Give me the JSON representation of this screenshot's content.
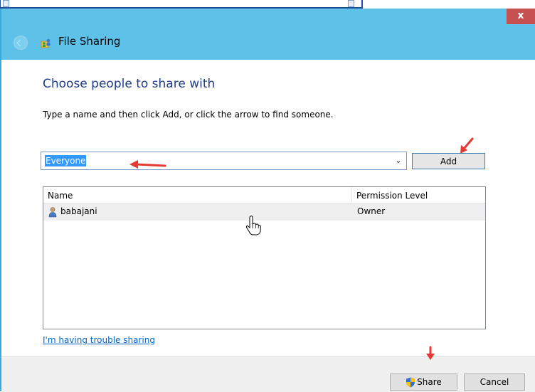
{
  "window": {
    "title": "File Sharing",
    "close_label": "x"
  },
  "main": {
    "heading": "Choose people to share with",
    "instruction": "Type a name and then click Add, or click the arrow to find someone.",
    "name_input_value": "Everyone",
    "add_label": "Add",
    "columns": [
      "Name",
      "Permission Level"
    ],
    "rows": [
      {
        "name": "babajani",
        "permission": "Owner"
      }
    ],
    "trouble_link": "I'm having trouble sharing"
  },
  "footer": {
    "share_label": "Share",
    "cancel_label": "Cancel"
  },
  "icons": {
    "back": "back-arrow-icon",
    "title": "file-sharing-icon",
    "user": "user-icon",
    "shield": "uac-shield-icon",
    "dropdown": "chevron-down-icon"
  },
  "colors": {
    "titlebar": "#5ec2e8",
    "heading": "#1f3c88",
    "annotation_arrow": "#e53935",
    "link": "#0066cc"
  }
}
